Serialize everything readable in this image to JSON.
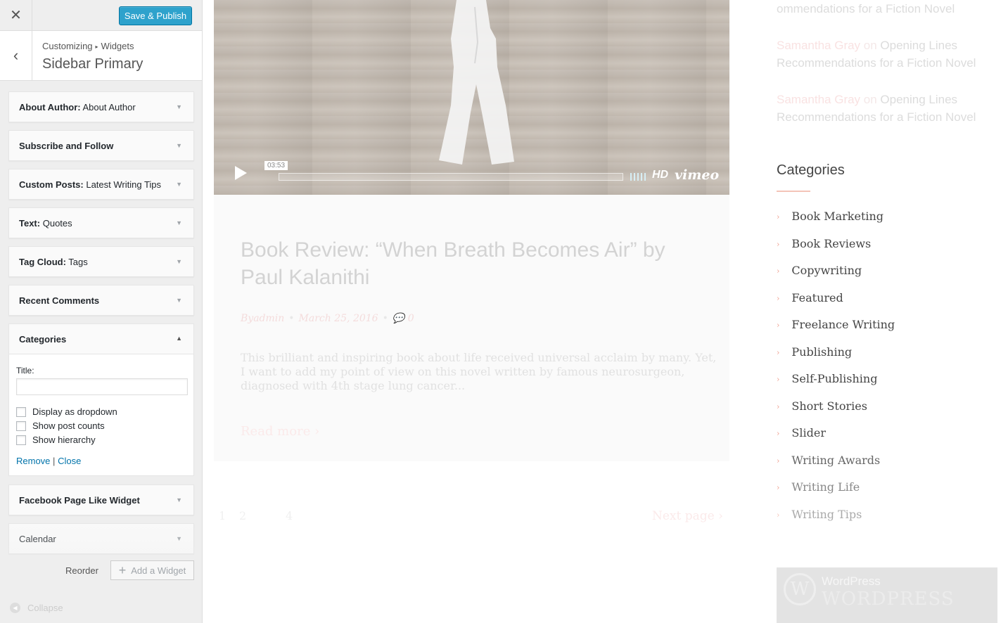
{
  "customizer": {
    "close_icon": "close-icon",
    "save_label": "Save & Publish",
    "breadcrumb_root": "Customizing",
    "breadcrumb_section": "Widgets",
    "section_title": "Sidebar Primary",
    "widgets": [
      {
        "name": "About Author:",
        "sub": " About Author"
      },
      {
        "name": "Subscribe and Follow",
        "sub": ""
      },
      {
        "name": "Custom Posts:",
        "sub": " Latest Writing Tips"
      },
      {
        "name": "Text:",
        "sub": " Quotes"
      },
      {
        "name": "Tag Cloud:",
        "sub": " Tags"
      },
      {
        "name": "Recent Comments",
        "sub": ""
      }
    ],
    "open_widget": {
      "name": "Categories",
      "title_label": "Title:",
      "title_value": "",
      "options": [
        "Display as dropdown",
        "Show post counts",
        "Show hierarchy"
      ],
      "remove_label": "Remove",
      "separator": "|",
      "close_label": "Close"
    },
    "widgets_after": [
      {
        "name": "Facebook Page Like Widget"
      },
      {
        "name": "Calendar"
      }
    ],
    "reorder_label": "Reorder",
    "add_widget_label": "Add a Widget",
    "collapse_label": "Collapse"
  },
  "preview": {
    "video": {
      "time": "03:53",
      "hd": "HD",
      "logo": "vimeo"
    },
    "post": {
      "title": "Book Review: “When Breath Becomes Air” by Paul Kalanithi",
      "meta_by": "By",
      "meta_author": "admin",
      "meta_date": "March 25, 2016",
      "meta_comments": "0",
      "excerpt": "This brilliant and inspiring book about life received universal acclaim by many. Yet, I want to add my point of view on this novel written by famous neurosurgeon, diagnosed with 4th stage lung cancer...",
      "read_more": "Read more"
    },
    "pagination": {
      "pages": [
        "1",
        "2",
        "4"
      ],
      "next": "Next page"
    },
    "recent_comments": [
      {
        "author": "",
        "on": "",
        "title": "ommendations for a Fiction Novel"
      },
      {
        "author": "Samantha Gray",
        "on": " on ",
        "title": "Opening Lines Recommendations for a Fiction Novel"
      },
      {
        "author": "Samantha Gray",
        "on": " on ",
        "title": "Opening Lines Recommendations for a Fiction Novel"
      }
    ],
    "categories_title": "Categories",
    "categories": [
      "Book Marketing",
      "Book Reviews",
      "Copywriting",
      "Featured",
      "Freelance Writing",
      "Publishing",
      "Self-Publishing",
      "Short Stories",
      "Slider",
      "Writing Awards",
      "Writing Life",
      "Writing Tips"
    ],
    "wp_badge": {
      "line1": "WordPress",
      "line2": "",
      "logo_text": "WORDPRESS"
    }
  }
}
